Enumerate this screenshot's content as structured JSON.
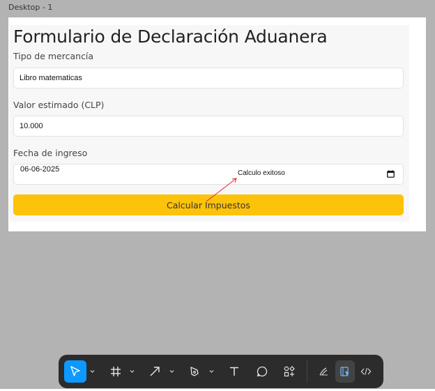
{
  "canvas": {
    "frame_label": "Desktop - 1"
  },
  "form": {
    "title": "Formulario de Declaración Aduanera",
    "fields": [
      {
        "label": "Tipo de mercancía",
        "value": "Libro  matematicas"
      },
      {
        "label": "Valor estimado (CLP)",
        "value": "10.000"
      },
      {
        "label": "Fecha de ingreso",
        "value": "06-06-2025"
      }
    ],
    "submit_label": "Calcular Impuestos"
  },
  "annotation": {
    "text": "Calculo exitoso",
    "color": "#e0242b"
  },
  "toolbar": {
    "tools": [
      {
        "icon": "move-cursor-icon",
        "active": true
      },
      {
        "icon": "frame-icon"
      },
      {
        "icon": "arrow-line-icon"
      },
      {
        "icon": "pen-icon"
      },
      {
        "icon": "text-icon"
      },
      {
        "icon": "comment-icon"
      },
      {
        "icon": "actions-icon"
      },
      {
        "icon": "draw-mode-icon"
      },
      {
        "icon": "design-mode-icon",
        "active": true
      },
      {
        "icon": "dev-mode-icon"
      }
    ]
  },
  "colors": {
    "canvas_bg": "#b3b3b3",
    "button_accent": "#fdc20a",
    "toolbar_bg": "#2c2c2c",
    "tool_active": "#0d99ff"
  }
}
